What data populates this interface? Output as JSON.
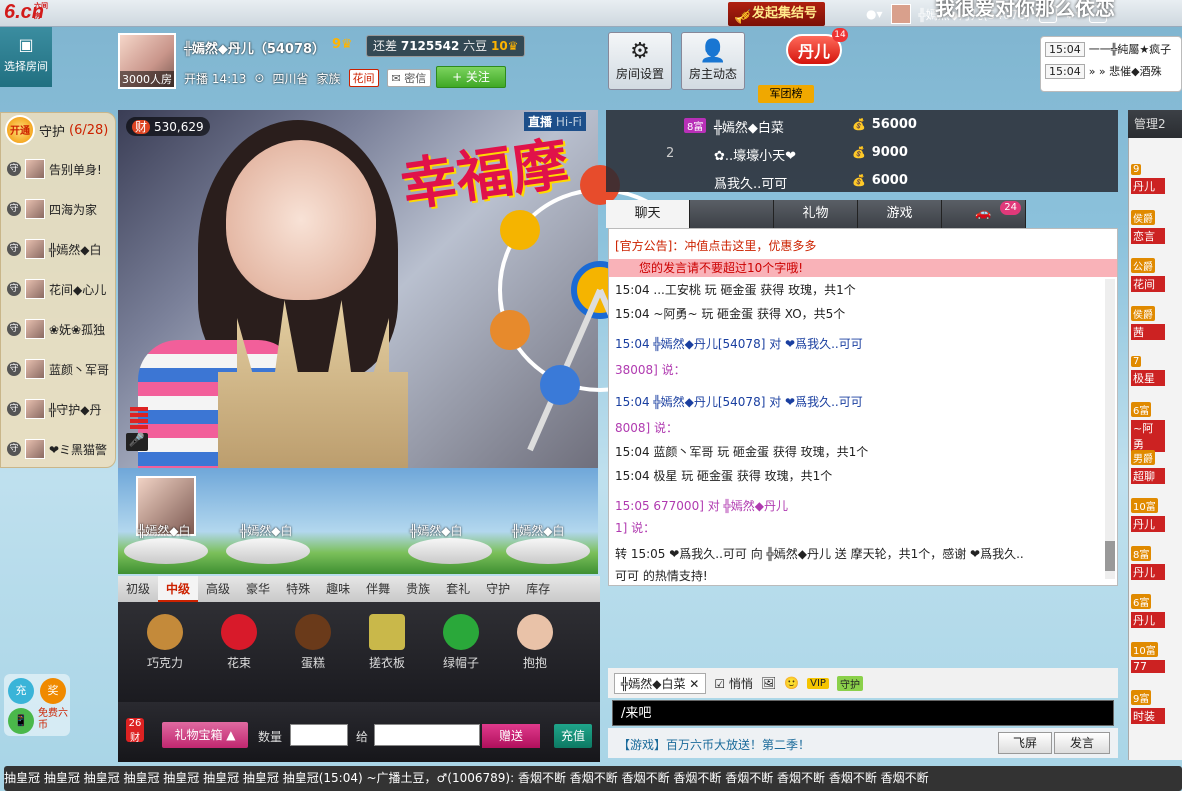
{
  "top": {
    "logo": "6.cn",
    "logo_sub": "六间房",
    "rally_button": "发起集结号",
    "scroll_title": "我很爱对你那么依恋",
    "user_name": "╬嫣然◆丹儿(54078)"
  },
  "left_header": {
    "choose_room": "选择房间"
  },
  "host": {
    "avatar_label": "3000人房",
    "name": "╬嫣然◆丹儿（54078）",
    "gap_label": "还差",
    "gap_value": "7125542",
    "gap_unit": "六豆",
    "level": "10",
    "live_time": "开播 14:13",
    "location": "四川省",
    "family_label": "家族",
    "family_tag": "花间",
    "mail": "密信",
    "follow": "+ 关注"
  },
  "tools": {
    "room_settings": "房间设置",
    "host_dynamic": "房主动态",
    "dan_badge": "丹儿",
    "dan_num": "14",
    "army": "军团榜"
  },
  "clock": [
    {
      "time": "15:04",
      "text": "一一╬純屬★疯子"
    },
    {
      "time": "15:04",
      "text": "» » 悲催◆酒殊"
    }
  ],
  "guard": {
    "open": "开通",
    "title": "守护",
    "count": "(6/28)",
    "items": [
      "告别单身!",
      "四海为家",
      "╬嫣然◆白",
      "花间◆心儿",
      "❀妩❀孤独",
      "蓝颜丶军哥",
      "╬守护◆丹",
      "❤ミ黑猫警"
    ]
  },
  "video": {
    "wealth_prefix": "财",
    "wealth": "530,629",
    "live_tag": "直播",
    "live_quality": "Hi-Fi",
    "festival": "幸福摩",
    "seats": [
      "╬嫣然◆白",
      "╬嫣然◆白",
      "╬嫣然◆白",
      "╬嫣然◆白"
    ]
  },
  "gift": {
    "tabs": [
      "初级",
      "中级",
      "高级",
      "豪华",
      "特殊",
      "趣味",
      "伴舞",
      "贵族",
      "套礼",
      "守护",
      "库存"
    ],
    "active_tab": "中级",
    "items": [
      {
        "name": "巧克力",
        "color": "#c48a3a"
      },
      {
        "name": "花束",
        "color": "#d81a2a"
      },
      {
        "name": "蛋糕",
        "color": "#6a3a1a"
      },
      {
        "name": "搓衣板",
        "color": "#c9b84a"
      },
      {
        "name": "绿帽子",
        "color": "#2aa83a"
      },
      {
        "name": "抱抱",
        "color": "#e9c2a8"
      }
    ],
    "count_badge": "26",
    "count_label": "财",
    "box_button": "礼物宝箱 ▲",
    "qty_label": "数量",
    "to_label": "给",
    "send": "赠送",
    "recharge": "充值"
  },
  "ranking": [
    {
      "n": "",
      "lv": "8富",
      "name": "╬嫣然◆白菜",
      "value": "56000"
    },
    {
      "n": "2",
      "lv": "",
      "name": "✿..壕壕小天❤",
      "value": "9000"
    },
    {
      "n": "",
      "lv": "",
      "name": "爲我久..可可",
      "value": "6000"
    }
  ],
  "chat_tabs": [
    "聊天",
    "",
    "礼物",
    "游戏",
    ""
  ],
  "car_count": "24",
  "chat": {
    "announce": "[官方公告]：冲值点击这里，优惠多多",
    "notice": "您的发言请不要超过10个字哦!",
    "lines": [
      "15:04 ...工安桃 玩 砸金蛋 获得 玫瑰，共1个",
      "15:04 ~阿勇~ 玩 砸金蛋 获得 XO，共5个",
      "15:04 ╬嫣然◆丹儿[54078] 对 ❤爲我久..可可",
      "38008] 说：",
      "15:04 ╬嫣然◆丹儿[54078] 对 ❤爲我久..可可",
      "8008] 说：",
      "15:04 蓝颜丶军哥 玩 砸金蛋 获得 玫瑰，共1个",
      "15:04 极星 玩 砸金蛋 获得 玫瑰，共1个",
      "15:05 677000] 对 ╬嫣然◆丹儿",
      "1] 说：",
      "转 15:05 ❤爲我久..可可 向 ╬嫣然◆丹儿 送 摩天轮，共1个，感谢 ❤爲我久..",
      "可可 的热情支持!"
    ]
  },
  "input": {
    "target": "╬嫣然◆白菜",
    "whisper": "悄悄",
    "vip": "VIP",
    "guard": "守护",
    "text": "/来吧",
    "game_tip": "【游戏】百万六币大放送！第二季！",
    "fly": "飞屏",
    "say": "发言"
  },
  "right": {
    "admin": "管理2",
    "items": [
      {
        "lv": "9",
        "name": "丹儿"
      },
      {
        "lv": "侯爵",
        "name": "恋言"
      },
      {
        "lv": "公爵",
        "name": "花间"
      },
      {
        "lv": "侯爵",
        "name": "茜"
      },
      {
        "lv": "7",
        "name": "极星"
      },
      {
        "lv": "6富",
        "name": "~阿勇"
      },
      {
        "lv": "男爵",
        "name": "超聊"
      },
      {
        "lv": "10富",
        "name": "丹儿"
      },
      {
        "lv": "8富",
        "name": "丹儿"
      },
      {
        "lv": "6富",
        "name": "丹儿"
      },
      {
        "lv": "10富",
        "name": "77"
      },
      {
        "lv": "9富",
        "name": "时装"
      }
    ]
  },
  "side": {
    "charge": "充",
    "award": "奖",
    "free": "免费六币"
  },
  "bottom": "抽皇冠 抽皇冠 抽皇冠 抽皇冠 抽皇冠 抽皇冠 抽皇冠 抽皇冠(15:04) ~广播土豆，♂(1006789): 香烟不断 香烟不断 香烟不断 香烟不断 香烟不断 香烟不断 香烟不断 香烟不断"
}
